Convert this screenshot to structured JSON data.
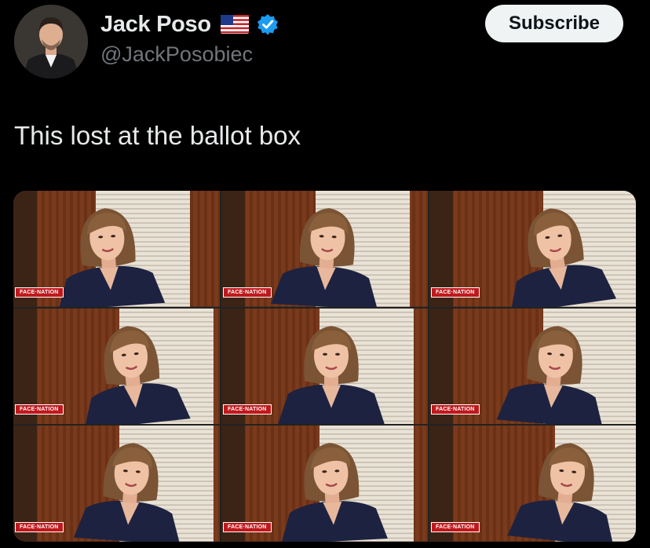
{
  "author": {
    "display_name": "Jack Poso",
    "handle": "@JackPosobiec",
    "flag_icon": "us-flag-icon",
    "verified_icon": "verified-badge-icon"
  },
  "subscribe": {
    "label": "Subscribe"
  },
  "tweet": {
    "text": "This lost at the ballot box"
  },
  "media": {
    "grid": "3x3",
    "tiles": [
      {
        "bug": "FACE·NATION"
      },
      {
        "bug": "FACE·NATION"
      },
      {
        "bug": "FACE·NATION"
      },
      {
        "bug": "FACE·NATION"
      },
      {
        "bug": "FACE·NATION"
      },
      {
        "bug": "FACE·NATION"
      },
      {
        "bug": "FACE·NATION"
      },
      {
        "bug": "FACE·NATION"
      },
      {
        "bug": "FACE·NATION"
      }
    ]
  },
  "colors": {
    "background": "#000000",
    "text_primary": "#e7e9ea",
    "text_secondary": "#71767b",
    "verified": "#1d9bf0",
    "button_bg": "#eff3f4",
    "tv_bug": "#c0181c"
  }
}
